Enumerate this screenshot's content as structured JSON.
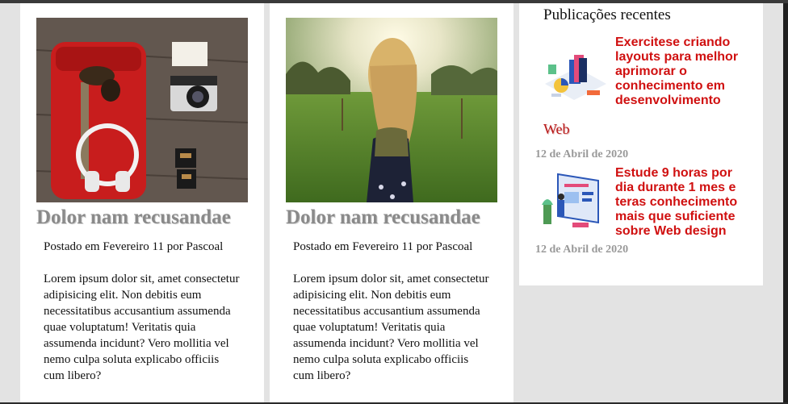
{
  "cards": [
    {
      "title": "Dolor nam recusandae",
      "meta": "Postado em Fevereiro 11 por Pascoal",
      "body": "Lorem ipsum dolor sit, amet consectetur adipisicing elit. Non debitis eum necessitatibus accusantium assumenda quae voluptatum! Veritatis quia assumenda incidunt? Vero mollitia vel nemo culpa soluta explicabo officiis cum libero?"
    },
    {
      "title": "Dolor nam recusandae",
      "meta": "Postado em Fevereiro 11 por Pascoal",
      "body": "Lorem ipsum dolor sit, amet consectetur adipisicing elit. Non debitis eum necessitatibus accusantium assumenda quae voluptatum! Veritatis quia assumenda incidunt? Vero mollitia vel nemo culpa soluta explicabo officiis cum libero?"
    }
  ],
  "sidebar": {
    "heading": "Publicações recentes",
    "posts": [
      {
        "title": "Exercitese criando layouts para melhor aprimorar o conhecimento em desenvolvimento",
        "title_cont": "Web",
        "date": "12 de Abril de 2020"
      },
      {
        "title": "Estude 9 horas por dia durante 1 mes e teras conhecimento mais que suficiente sobre Web design",
        "date": "12 de Abril de 2020"
      }
    ]
  },
  "colors": {
    "accent_red": "#d01010",
    "title_gray": "#8a8a8a",
    "date_gray": "#999999",
    "background": "#e3e3e3"
  }
}
